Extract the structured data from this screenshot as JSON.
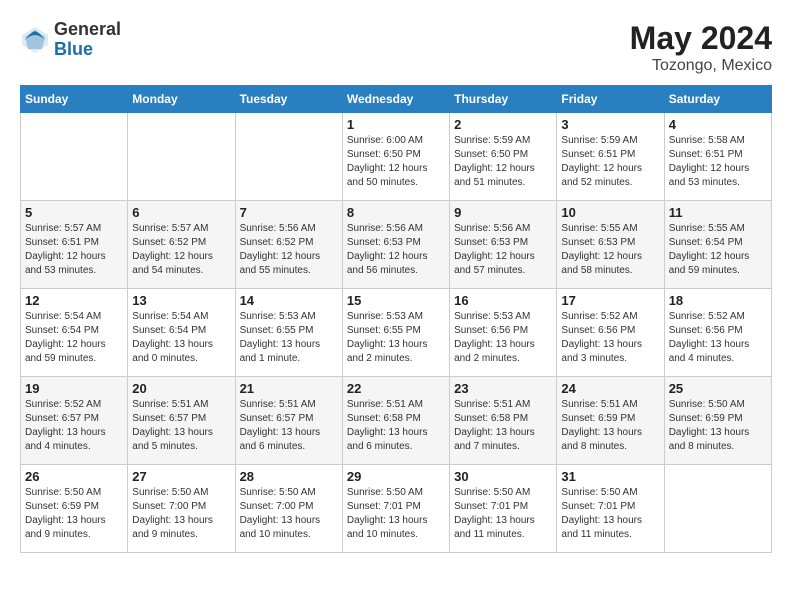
{
  "header": {
    "logo_general": "General",
    "logo_blue": "Blue",
    "title": "May 2024",
    "subtitle": "Tozongo, Mexico"
  },
  "calendar": {
    "days_of_week": [
      "Sunday",
      "Monday",
      "Tuesday",
      "Wednesday",
      "Thursday",
      "Friday",
      "Saturday"
    ],
    "weeks": [
      [
        {
          "day": "",
          "info": ""
        },
        {
          "day": "",
          "info": ""
        },
        {
          "day": "",
          "info": ""
        },
        {
          "day": "1",
          "info": "Sunrise: 6:00 AM\nSunset: 6:50 PM\nDaylight: 12 hours\nand 50 minutes."
        },
        {
          "day": "2",
          "info": "Sunrise: 5:59 AM\nSunset: 6:50 PM\nDaylight: 12 hours\nand 51 minutes."
        },
        {
          "day": "3",
          "info": "Sunrise: 5:59 AM\nSunset: 6:51 PM\nDaylight: 12 hours\nand 52 minutes."
        },
        {
          "day": "4",
          "info": "Sunrise: 5:58 AM\nSunset: 6:51 PM\nDaylight: 12 hours\nand 53 minutes."
        }
      ],
      [
        {
          "day": "5",
          "info": "Sunrise: 5:57 AM\nSunset: 6:51 PM\nDaylight: 12 hours\nand 53 minutes."
        },
        {
          "day": "6",
          "info": "Sunrise: 5:57 AM\nSunset: 6:52 PM\nDaylight: 12 hours\nand 54 minutes."
        },
        {
          "day": "7",
          "info": "Sunrise: 5:56 AM\nSunset: 6:52 PM\nDaylight: 12 hours\nand 55 minutes."
        },
        {
          "day": "8",
          "info": "Sunrise: 5:56 AM\nSunset: 6:53 PM\nDaylight: 12 hours\nand 56 minutes."
        },
        {
          "day": "9",
          "info": "Sunrise: 5:56 AM\nSunset: 6:53 PM\nDaylight: 12 hours\nand 57 minutes."
        },
        {
          "day": "10",
          "info": "Sunrise: 5:55 AM\nSunset: 6:53 PM\nDaylight: 12 hours\nand 58 minutes."
        },
        {
          "day": "11",
          "info": "Sunrise: 5:55 AM\nSunset: 6:54 PM\nDaylight: 12 hours\nand 59 minutes."
        }
      ],
      [
        {
          "day": "12",
          "info": "Sunrise: 5:54 AM\nSunset: 6:54 PM\nDaylight: 12 hours\nand 59 minutes."
        },
        {
          "day": "13",
          "info": "Sunrise: 5:54 AM\nSunset: 6:54 PM\nDaylight: 13 hours\nand 0 minutes."
        },
        {
          "day": "14",
          "info": "Sunrise: 5:53 AM\nSunset: 6:55 PM\nDaylight: 13 hours\nand 1 minute."
        },
        {
          "day": "15",
          "info": "Sunrise: 5:53 AM\nSunset: 6:55 PM\nDaylight: 13 hours\nand 2 minutes."
        },
        {
          "day": "16",
          "info": "Sunrise: 5:53 AM\nSunset: 6:56 PM\nDaylight: 13 hours\nand 2 minutes."
        },
        {
          "day": "17",
          "info": "Sunrise: 5:52 AM\nSunset: 6:56 PM\nDaylight: 13 hours\nand 3 minutes."
        },
        {
          "day": "18",
          "info": "Sunrise: 5:52 AM\nSunset: 6:56 PM\nDaylight: 13 hours\nand 4 minutes."
        }
      ],
      [
        {
          "day": "19",
          "info": "Sunrise: 5:52 AM\nSunset: 6:57 PM\nDaylight: 13 hours\nand 4 minutes."
        },
        {
          "day": "20",
          "info": "Sunrise: 5:51 AM\nSunset: 6:57 PM\nDaylight: 13 hours\nand 5 minutes."
        },
        {
          "day": "21",
          "info": "Sunrise: 5:51 AM\nSunset: 6:57 PM\nDaylight: 13 hours\nand 6 minutes."
        },
        {
          "day": "22",
          "info": "Sunrise: 5:51 AM\nSunset: 6:58 PM\nDaylight: 13 hours\nand 6 minutes."
        },
        {
          "day": "23",
          "info": "Sunrise: 5:51 AM\nSunset: 6:58 PM\nDaylight: 13 hours\nand 7 minutes."
        },
        {
          "day": "24",
          "info": "Sunrise: 5:51 AM\nSunset: 6:59 PM\nDaylight: 13 hours\nand 8 minutes."
        },
        {
          "day": "25",
          "info": "Sunrise: 5:50 AM\nSunset: 6:59 PM\nDaylight: 13 hours\nand 8 minutes."
        }
      ],
      [
        {
          "day": "26",
          "info": "Sunrise: 5:50 AM\nSunset: 6:59 PM\nDaylight: 13 hours\nand 9 minutes."
        },
        {
          "day": "27",
          "info": "Sunrise: 5:50 AM\nSunset: 7:00 PM\nDaylight: 13 hours\nand 9 minutes."
        },
        {
          "day": "28",
          "info": "Sunrise: 5:50 AM\nSunset: 7:00 PM\nDaylight: 13 hours\nand 10 minutes."
        },
        {
          "day": "29",
          "info": "Sunrise: 5:50 AM\nSunset: 7:01 PM\nDaylight: 13 hours\nand 10 minutes."
        },
        {
          "day": "30",
          "info": "Sunrise: 5:50 AM\nSunset: 7:01 PM\nDaylight: 13 hours\nand 11 minutes."
        },
        {
          "day": "31",
          "info": "Sunrise: 5:50 AM\nSunset: 7:01 PM\nDaylight: 13 hours\nand 11 minutes."
        },
        {
          "day": "",
          "info": ""
        }
      ]
    ]
  }
}
